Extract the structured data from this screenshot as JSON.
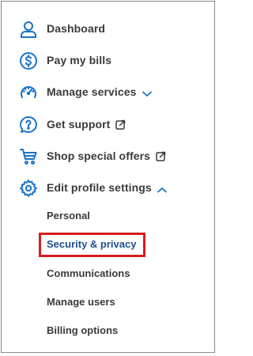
{
  "menu": {
    "items": [
      {
        "label": "Dashboard",
        "icon": "user-icon"
      },
      {
        "label": "Pay my bills",
        "icon": "dollar-circle-icon"
      },
      {
        "label": "Manage services",
        "icon": "speedometer-icon",
        "trailing_icon": "chevron-down-icon"
      },
      {
        "label": "Get support",
        "icon": "question-bubble-icon",
        "trailing_icon": "external-link-icon"
      },
      {
        "label": "Shop special offers",
        "icon": "shopping-cart-icon",
        "trailing_icon": "external-link-icon"
      },
      {
        "label": "Edit profile settings",
        "icon": "gear-icon",
        "trailing_icon": "chevron-up-icon",
        "expanded": true
      }
    ],
    "submenu": [
      {
        "label": "Personal"
      },
      {
        "label": "Security & privacy",
        "active": true
      },
      {
        "label": "Communications"
      },
      {
        "label": "Manage users"
      },
      {
        "label": "Billing options"
      }
    ]
  },
  "colors": {
    "icon": "#1a73c8",
    "text": "#3a3a3a",
    "active_text": "#1f4e8c",
    "highlight": "#d81d1d",
    "border": "#8a8a8a"
  }
}
